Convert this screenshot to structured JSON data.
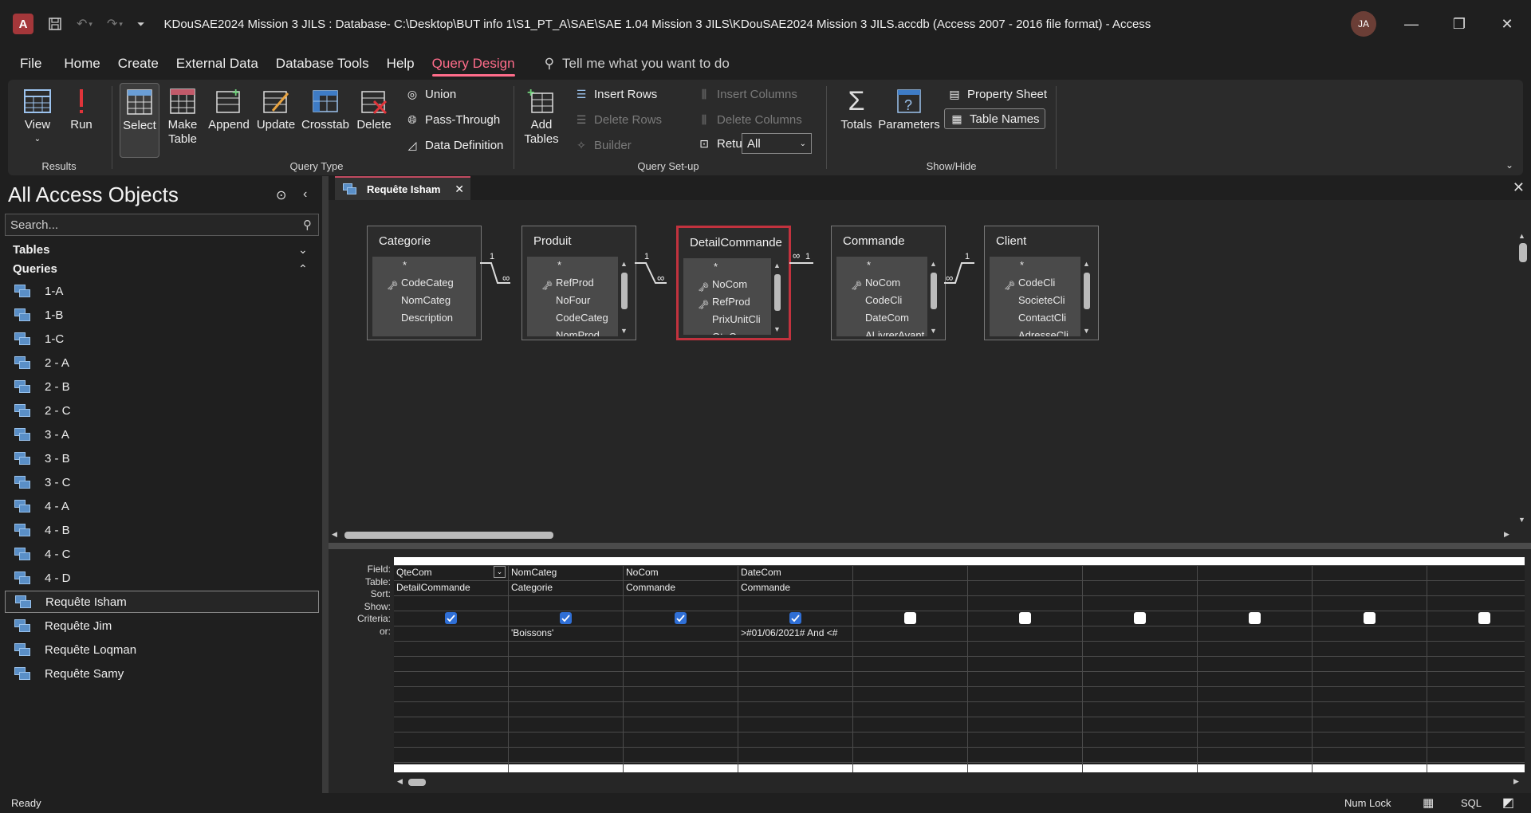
{
  "title_bar": {
    "app_logo": "A",
    "title": "KDouSAE2024 Mission 3 JILS : Database- C:\\Desktop\\BUT info 1\\S1_PT_A\\SAE\\SAE 1.04 Mission 3 JILS\\KDouSAE2024 Mission 3 JILS.accdb (Access 2007 - 2016 file format)  -  Access",
    "avatar": "JA"
  },
  "menu": [
    "File",
    "Home",
    "Create",
    "External Data",
    "Database Tools",
    "Help",
    "Query Design"
  ],
  "tell_me": "Tell me what you want to do",
  "ribbon": {
    "results": {
      "label": "Results",
      "view": "View",
      "run": "Run"
    },
    "query_type": {
      "label": "Query Type",
      "select": "Select",
      "make_table": "Make Table",
      "append": "Append",
      "update": "Update",
      "crosstab": "Crosstab",
      "delete": "Delete",
      "union": "Union",
      "pass_through": "Pass-Through",
      "data_definition": "Data Definition"
    },
    "query_setup": {
      "label": "Query Set-up",
      "add_tables": "Add Tables",
      "insert_rows": "Insert Rows",
      "delete_rows": "Delete Rows",
      "builder": "Builder",
      "insert_columns": "Insert Columns",
      "delete_columns": "Delete Columns",
      "return_label": "Return:",
      "return_value": "All"
    },
    "show_hide": {
      "label": "Show/Hide",
      "totals": "Totals",
      "parameters": "Parameters",
      "property_sheet": "Property Sheet",
      "table_names": "Table Names"
    }
  },
  "nav": {
    "title": "All Access Objects",
    "search_placeholder": "Search...",
    "tables": "Tables",
    "queries": "Queries",
    "items": [
      "1-A",
      "1-B",
      "1-C",
      "2 - A",
      "2 - B",
      "2 - C",
      "3 - A",
      "3 - B",
      "3 - C",
      "4 - A",
      "4 - B",
      "4 - C",
      "4 - D",
      "Requête Isham",
      "Requête Jim",
      "Requête Loqman",
      "Requête Samy"
    ],
    "selected": "Requête Isham"
  },
  "document_tab": "Requête Isham",
  "tables": [
    {
      "name": "Categorie",
      "fields": [
        "CodeCateg",
        "NomCateg",
        "Description"
      ],
      "keys": [
        0
      ]
    },
    {
      "name": "Produit",
      "fields": [
        "RefProd",
        "NoFour",
        "CodeCateg",
        "NomProd"
      ],
      "keys": [
        0
      ]
    },
    {
      "name": "DetailCommande",
      "fields": [
        "NoCom",
        "RefProd",
        "PrixUnitCli",
        "QteCom"
      ],
      "keys": [
        0,
        1
      ]
    },
    {
      "name": "Commande",
      "fields": [
        "NoCom",
        "CodeCli",
        "DateCom",
        "ALivrerAvant"
      ],
      "keys": [
        0
      ]
    },
    {
      "name": "Client",
      "fields": [
        "CodeCli",
        "SocieteCli",
        "ContactCli",
        "AdresseCli"
      ],
      "keys": [
        0
      ]
    }
  ],
  "relation_labels": {
    "one": "1",
    "many": "∞"
  },
  "grid": {
    "row_labels": [
      "Field:",
      "Table:",
      "Sort:",
      "Show:",
      "Criteria:",
      "or:"
    ],
    "columns": [
      {
        "field": "QteCom",
        "table": "DetailCommande",
        "sort": "",
        "show": true,
        "criteria": ""
      },
      {
        "field": "NomCateg",
        "table": "Categorie",
        "sort": "",
        "show": true,
        "criteria": "'Boissons'"
      },
      {
        "field": "NoCom",
        "table": "Commande",
        "sort": "",
        "show": true,
        "criteria": ""
      },
      {
        "field": "DateCom",
        "table": "Commande",
        "sort": "",
        "show": true,
        "criteria": ">#01/06/2021# And <#"
      },
      {
        "field": "",
        "table": "",
        "sort": "",
        "show": false,
        "criteria": ""
      },
      {
        "field": "",
        "table": "",
        "sort": "",
        "show": false,
        "criteria": ""
      },
      {
        "field": "",
        "table": "",
        "sort": "",
        "show": false,
        "criteria": ""
      },
      {
        "field": "",
        "table": "",
        "sort": "",
        "show": false,
        "criteria": ""
      },
      {
        "field": "",
        "table": "",
        "sort": "",
        "show": false,
        "criteria": ""
      },
      {
        "field": "",
        "table": "",
        "sort": "",
        "show": false,
        "criteria": ""
      }
    ]
  },
  "status": {
    "ready": "Ready",
    "num_lock": "Num Lock",
    "sql": "SQL"
  }
}
